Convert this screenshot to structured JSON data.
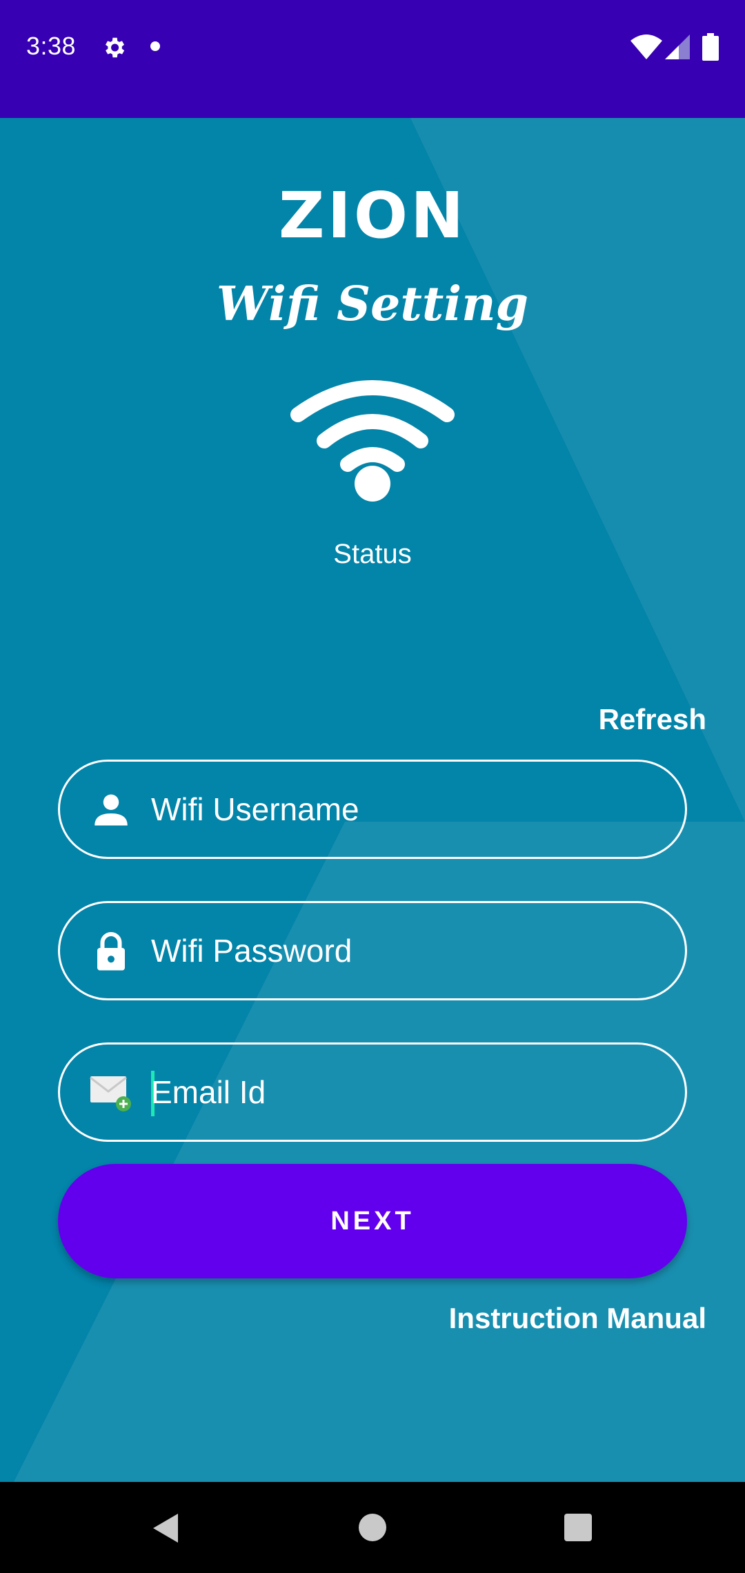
{
  "status_bar": {
    "time": "3:38"
  },
  "app": {
    "title": "ZION",
    "subtitle": "Wifi Setting",
    "status_label": "Status",
    "refresh_label": "Refresh"
  },
  "form": {
    "username_placeholder": "Wifi Username",
    "password_placeholder": "Wifi Password",
    "email_placeholder": "Email Id",
    "next_label": "NEXT"
  },
  "links": {
    "instruction_manual": "Instruction Manual"
  },
  "colors": {
    "status_bar": "#3700b3",
    "background": "#0384a9",
    "button": "#6200ee",
    "cursor": "#1de9b6"
  },
  "icons": {
    "status": [
      "settings-gear-icon",
      "notification-dot-icon",
      "wifi-signal-icon",
      "cell-signal-icon",
      "battery-icon"
    ],
    "fields": [
      "person-icon",
      "lock-icon",
      "email-add-icon"
    ],
    "nav": [
      "back-icon",
      "home-icon",
      "recents-icon"
    ]
  }
}
